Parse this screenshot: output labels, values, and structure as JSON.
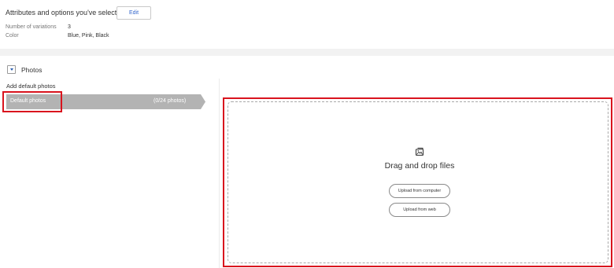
{
  "attributes": {
    "title": "Attributes and options you've selected",
    "edit_label": "Edit",
    "rows": [
      {
        "key": "Number of variations",
        "value": "3"
      },
      {
        "key": "Color",
        "value": "Blue, Pink, Black"
      }
    ]
  },
  "photos": {
    "section_title": "Photos",
    "add_default_label": "Add default photos",
    "default_bar": {
      "label": "Default photos",
      "count": "(0/24 photos)"
    },
    "dropzone": {
      "icon": "image-upload-icon",
      "text": "Drag and drop files",
      "upload_computer": "Upload from computer",
      "upload_web": "Upload from web"
    }
  },
  "colors": {
    "accent_link": "#3366cc",
    "highlight_red": "#d9141e",
    "bar_gray": "#b3b3b3"
  }
}
